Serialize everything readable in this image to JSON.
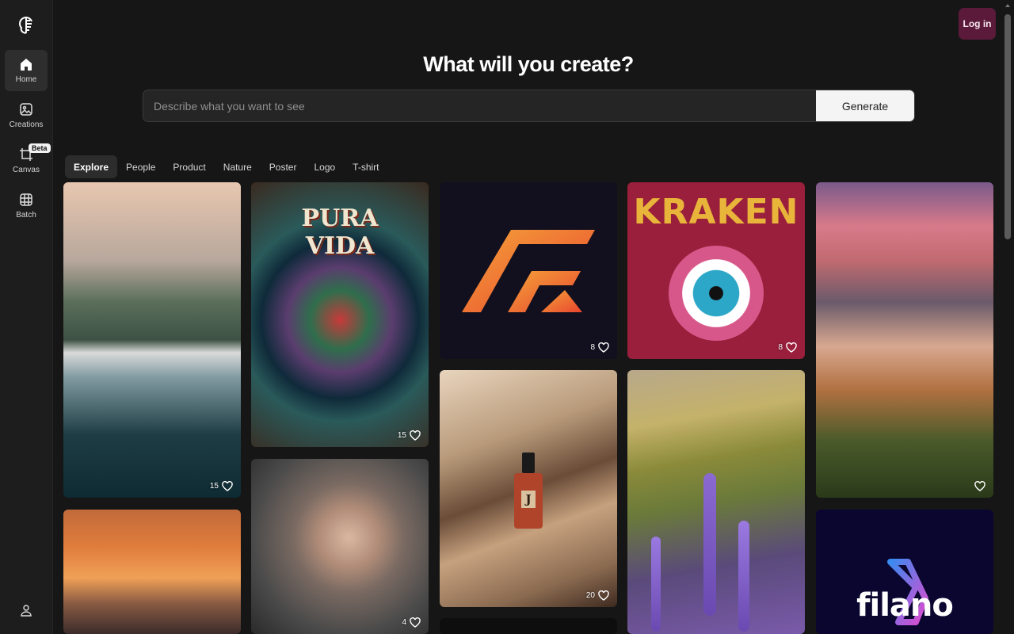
{
  "sidebar": {
    "items": [
      {
        "label": "Home",
        "icon": "home-icon",
        "active": true
      },
      {
        "label": "Creations",
        "icon": "image-icon"
      },
      {
        "label": "Canvas",
        "icon": "crop-icon",
        "badge": "Beta"
      },
      {
        "label": "Batch",
        "icon": "grid-icon"
      }
    ],
    "user_icon": "user-icon"
  },
  "header": {
    "login_label": "Log in",
    "title": "What will you create?"
  },
  "search": {
    "placeholder": "Describe what you want to see",
    "value": "",
    "generate_label": "Generate"
  },
  "tabs": [
    "Explore",
    "People",
    "Product",
    "Nature",
    "Poster",
    "Logo",
    "T-shirt"
  ],
  "gallery": [
    {
      "id": "c1",
      "likes": "15"
    },
    {
      "id": "c2",
      "likes": "15"
    },
    {
      "id": "c3",
      "likes": "8"
    },
    {
      "id": "c4",
      "likes": "8",
      "text": "KRAKEN"
    },
    {
      "id": "c5",
      "likes": ""
    },
    {
      "id": "c6",
      "likes": ""
    },
    {
      "id": "c7",
      "likes": "4"
    },
    {
      "id": "c8",
      "likes": "20"
    },
    {
      "id": "c9",
      "likes": ""
    },
    {
      "id": "c10",
      "likes": "",
      "text": "filano"
    },
    {
      "id": "c11",
      "likes": ""
    }
  ],
  "poster_text": "PURA VIDA",
  "bottle_letter": "J",
  "colors": {
    "accent": "#5c1a3a",
    "background": "#161616",
    "sidebar": "#1d1d1d"
  }
}
